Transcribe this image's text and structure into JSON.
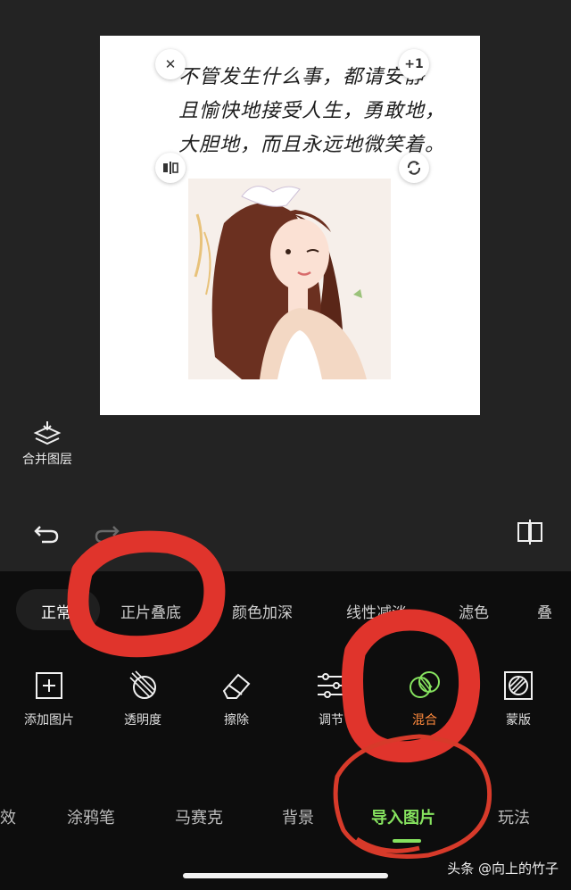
{
  "canvas": {
    "handwriting": [
      "不管发生什么事，都请安静",
      "且愉快地接受人生，勇敢地，",
      "大胆地，而且永远地微笑着。"
    ],
    "handles": {
      "close": "✕",
      "plus": "+1"
    }
  },
  "merge_layers_label": "合并图层",
  "blend_modes": [
    {
      "label": "正常",
      "active": true
    },
    {
      "label": "正片叠底",
      "active": false
    },
    {
      "label": "颜色加深",
      "active": false
    },
    {
      "label": "线性减淡",
      "active": false
    },
    {
      "label": "滤色",
      "active": false
    },
    {
      "label": "叠",
      "active": false
    }
  ],
  "tools": [
    {
      "label": "添加图片",
      "icon": "add-image-icon"
    },
    {
      "label": "透明度",
      "icon": "opacity-icon"
    },
    {
      "label": "擦除",
      "icon": "eraser-icon"
    },
    {
      "label": "调节",
      "icon": "adjust-sliders-icon"
    },
    {
      "label": "混合",
      "icon": "blend-icon",
      "active": true
    },
    {
      "label": "蒙版",
      "icon": "mask-icon"
    }
  ],
  "bottom_nav": [
    {
      "label": "效"
    },
    {
      "label": "涂鸦笔"
    },
    {
      "label": "马赛克"
    },
    {
      "label": "背景"
    },
    {
      "label": "导入图片",
      "active": true
    },
    {
      "label": "玩法"
    }
  ],
  "watermark": "头条 @向上的竹子",
  "colors": {
    "accent": "#86e35f",
    "annotation": "#e0342c",
    "active_tool": "#ff8a3d"
  }
}
